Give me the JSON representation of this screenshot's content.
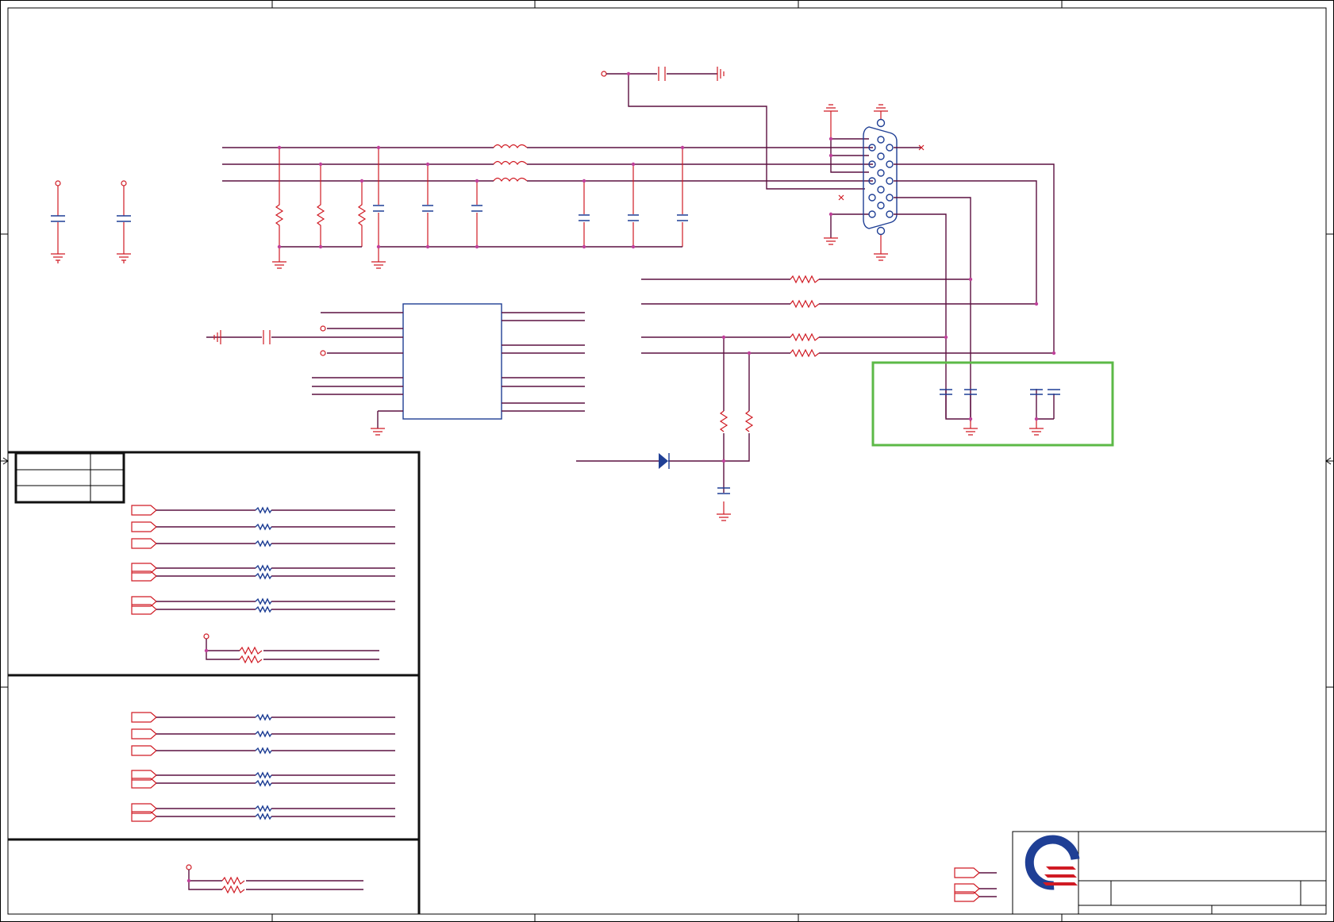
{
  "schematic": {
    "highlight_color": "#5cb947",
    "wire_color": "#5c1040",
    "part_color": "#d01b24",
    "symbol_color": "#1f3f95",
    "logo": {
      "name": "company-logo-icon",
      "colors": [
        "#1f3f95",
        "#d01b24"
      ]
    }
  }
}
